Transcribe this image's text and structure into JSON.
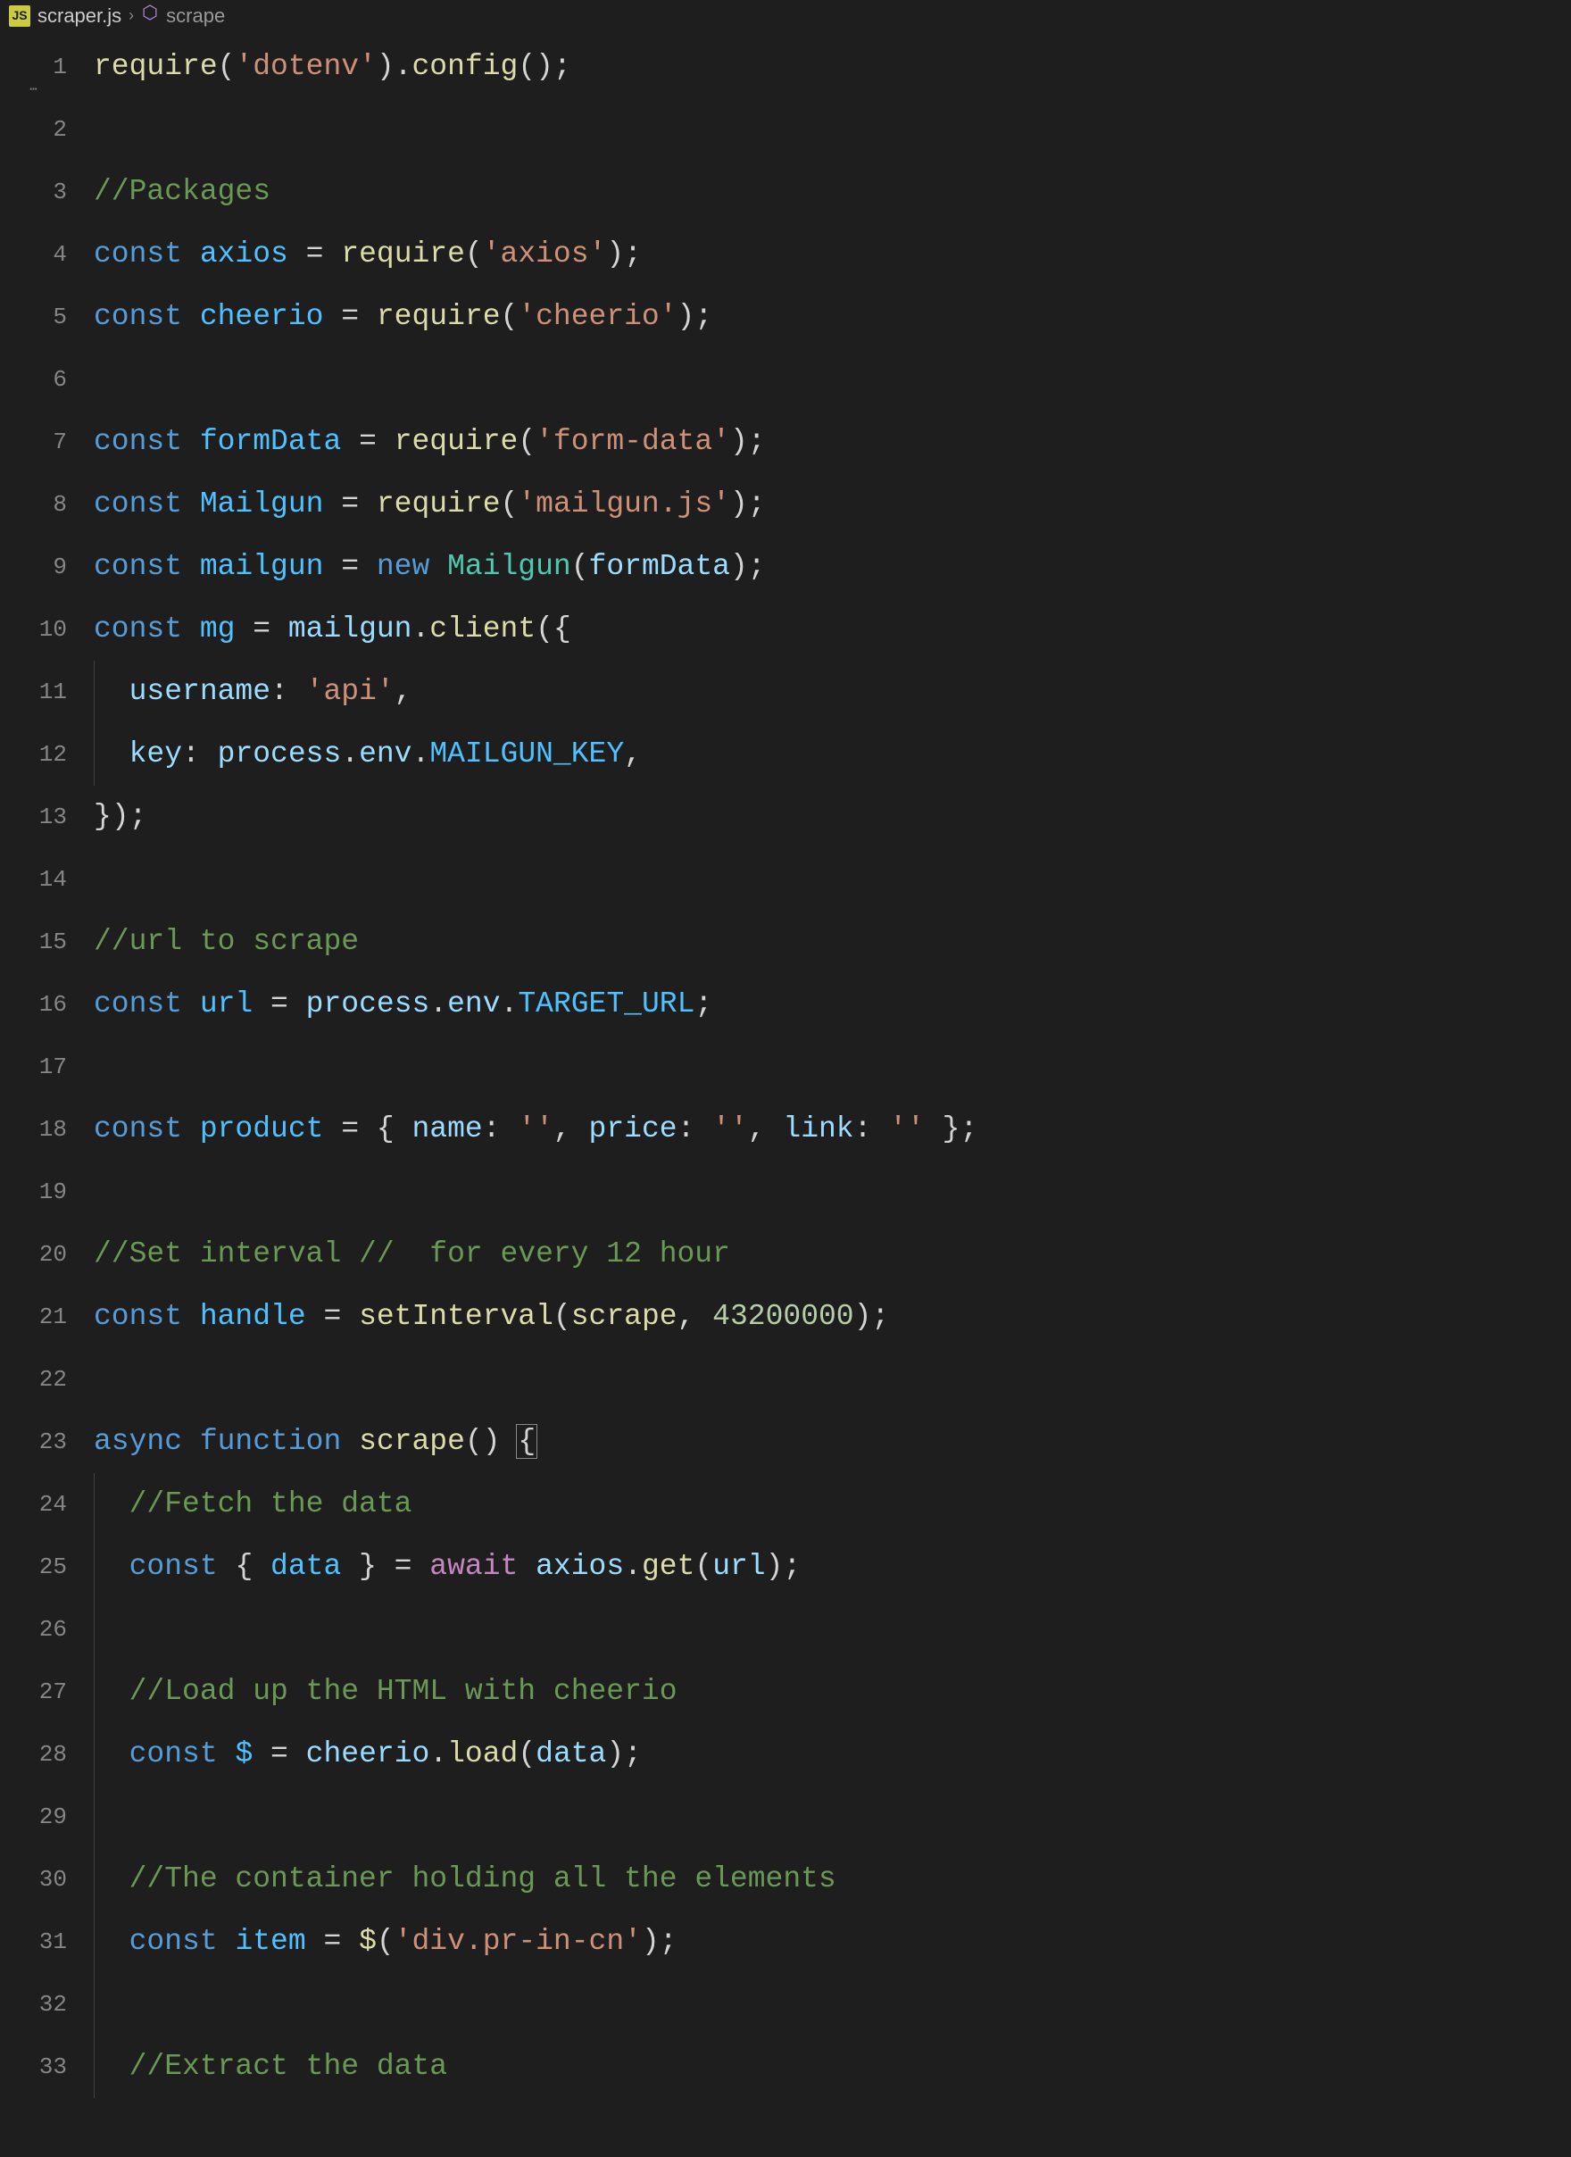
{
  "breadcrumb": {
    "file_icon": "JS",
    "file_name": "scraper.js",
    "chevron": "›",
    "symbol_name": "scrape"
  },
  "gutter": {
    "lines": [
      "1",
      "2",
      "3",
      "4",
      "5",
      "6",
      "7",
      "8",
      "9",
      "10",
      "11",
      "12",
      "13",
      "14",
      "15",
      "16",
      "17",
      "18",
      "19",
      "20",
      "21",
      "22",
      "23",
      "24",
      "25",
      "26",
      "27",
      "28",
      "29",
      "30",
      "31",
      "32",
      "33"
    ],
    "ellipsis": "⋯"
  },
  "code": {
    "l1": {
      "require": "require",
      "lp": "(",
      "str": "'dotenv'",
      "rp": ")",
      "dot": ".",
      "config": "config",
      "lp2": "(",
      "rp2": ")",
      "semi": ";"
    },
    "l3": {
      "comment": "//Packages"
    },
    "l4": {
      "const": "const ",
      "name": "axios",
      "eq": " = ",
      "require": "require",
      "lp": "(",
      "str": "'axios'",
      "rp": ")",
      "semi": ";"
    },
    "l5": {
      "const": "const ",
      "name": "cheerio",
      "eq": " = ",
      "require": "require",
      "lp": "(",
      "str": "'cheerio'",
      "rp": ")",
      "semi": ";"
    },
    "l7": {
      "const": "const ",
      "name": "formData",
      "eq": " = ",
      "require": "require",
      "lp": "(",
      "str": "'form-data'",
      "rp": ")",
      "semi": ";"
    },
    "l8": {
      "const": "const ",
      "name": "Mailgun",
      "eq": " = ",
      "require": "require",
      "lp": "(",
      "str": "'mailgun.js'",
      "rp": ")",
      "semi": ";"
    },
    "l9": {
      "const": "const ",
      "name": "mailgun",
      "eq": " = ",
      "new": "new ",
      "cls": "Mailgun",
      "lp": "(",
      "arg": "formData",
      "rp": ")",
      "semi": ";"
    },
    "l10": {
      "const": "const ",
      "name": "mg",
      "eq": " = ",
      "obj": "mailgun",
      "dot": ".",
      "method": "client",
      "lp": "(",
      "brace": "{"
    },
    "l11": {
      "indent": "  ",
      "key": "username",
      "colon": ": ",
      "str": "'api'",
      "comma": ","
    },
    "l12": {
      "indent": "  ",
      "key": "key",
      "colon": ": ",
      "obj": "process",
      "dot": ".",
      "env": "env",
      "dot2": ".",
      "envkey": "MAILGUN_KEY",
      "comma": ","
    },
    "l13": {
      "brace": "}",
      "rp": ")",
      "semi": ";"
    },
    "l15": {
      "comment": "//url to scrape"
    },
    "l16": {
      "const": "const ",
      "name": "url",
      "eq": " = ",
      "obj": "process",
      "dot": ".",
      "env": "env",
      "dot2": ".",
      "envkey": "TARGET_URL",
      "semi": ";"
    },
    "l18": {
      "const": "const ",
      "name": "product",
      "eq": " = ",
      "lb": "{ ",
      "k1": "name",
      "c1": ": ",
      "s1": "''",
      "cm1": ", ",
      "k2": "price",
      "c2": ": ",
      "s2": "''",
      "cm2": ", ",
      "k3": "link",
      "c3": ": ",
      "s3": "''",
      "rb": " }",
      "semi": ";"
    },
    "l20": {
      "comment": "//Set interval //  for every 12 hour"
    },
    "l21": {
      "const": "const ",
      "name": "handle",
      "eq": " = ",
      "fn": "setInterval",
      "lp": "(",
      "arg": "scrape",
      "comma": ", ",
      "num": "43200000",
      "rp": ")",
      "semi": ";"
    },
    "l23": {
      "async": "async ",
      "function": "function ",
      "name": "scrape",
      "lp": "(",
      "rp": ") ",
      "brace": "{"
    },
    "l24": {
      "indent": "  ",
      "comment": "//Fetch the data"
    },
    "l25": {
      "indent": "  ",
      "const": "const ",
      "lb": "{ ",
      "var": "data",
      "rb": " }",
      "eq": " = ",
      "await": "await ",
      "obj": "axios",
      "dot": ".",
      "method": "get",
      "lp": "(",
      "arg": "url",
      "rp": ")",
      "semi": ";"
    },
    "l27": {
      "indent": "  ",
      "comment": "//Load up the HTML with cheerio"
    },
    "l28": {
      "indent": "  ",
      "const": "const ",
      "name": "$",
      "eq": " = ",
      "obj": "cheerio",
      "dot": ".",
      "method": "load",
      "lp": "(",
      "arg": "data",
      "rp": ")",
      "semi": ";"
    },
    "l30": {
      "indent": "  ",
      "comment": "//The container holding all the elements"
    },
    "l31": {
      "indent": "  ",
      "const": "const ",
      "name": "item",
      "eq": " = ",
      "fn": "$",
      "lp": "(",
      "str": "'div.pr-in-cn'",
      "rp": ")",
      "semi": ";"
    },
    "l33": {
      "indent": "  ",
      "comment": "//Extract the data"
    }
  }
}
